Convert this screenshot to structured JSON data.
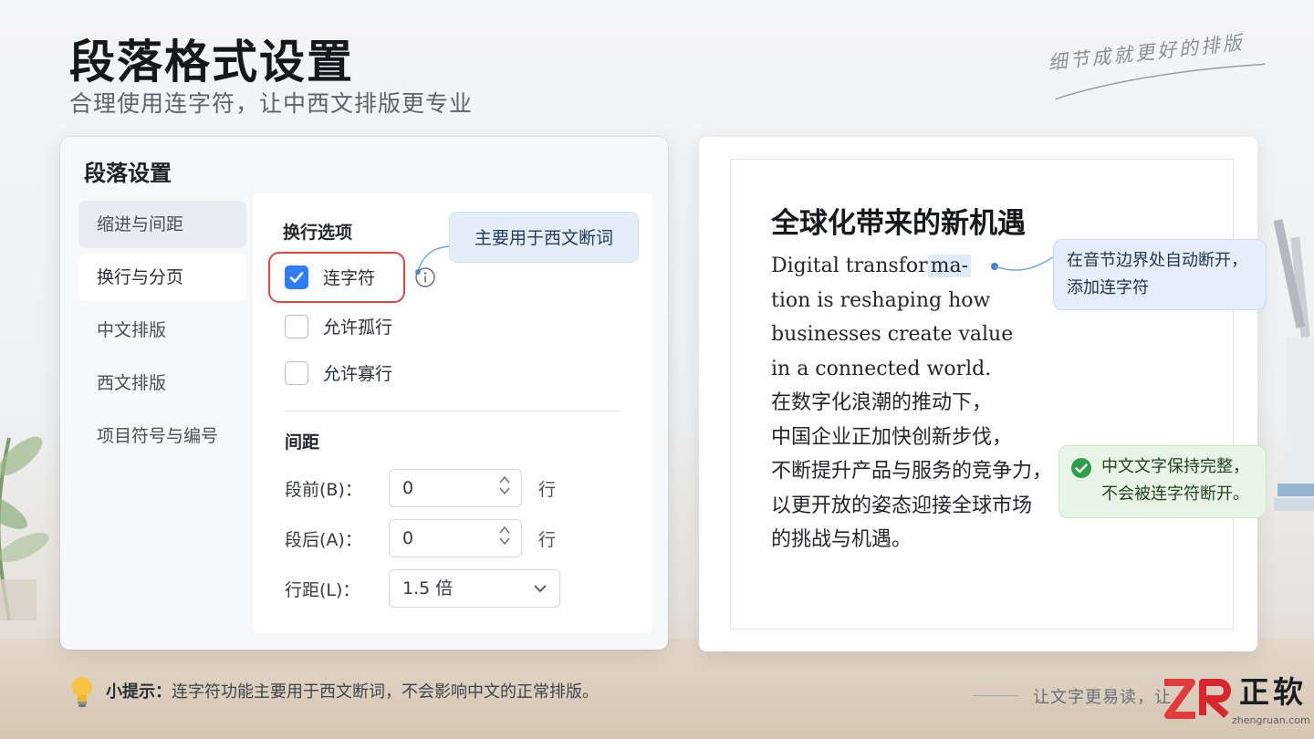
{
  "header": {
    "title": "段落格式设置",
    "subtitle": "合理使用连字符，让中西文排版更专业",
    "signature": "细节成就更好的排版"
  },
  "dialog": {
    "title": "段落设置",
    "nav": [
      {
        "label": "缩进与间距"
      },
      {
        "label": "换行与分页"
      },
      {
        "label": "中文排版"
      },
      {
        "label": "西文排版"
      },
      {
        "label": "项目符号与编号"
      }
    ],
    "line_break": {
      "title": "换行选项",
      "tooltip": "主要用于西文断词",
      "options": [
        {
          "label": "连字符",
          "checked": true
        },
        {
          "label": "允许孤行",
          "checked": false
        },
        {
          "label": "允许寡行",
          "checked": false
        }
      ]
    },
    "spacing": {
      "title": "间距",
      "before_label": "段前(B)：",
      "before_value": "0",
      "before_unit": "行",
      "after_label": "段后(A)：",
      "after_value": "0",
      "after_unit": "行",
      "line_label": "行距(L)：",
      "line_value": "1.5 倍"
    }
  },
  "document": {
    "title": "全球化带来的新机遇",
    "line1_main": "Digital transfor",
    "line1_mark": "ma-",
    "lines": [
      "tion is reshaping how",
      "businesses create value",
      "in a connected world.",
      "在数字化浪潮的推动下，",
      "中国企业正加快创新步伐，",
      "不断提升产品与服务的竞争力，",
      "以更开放的姿态迎接全球市场",
      "的挑战与机遇。"
    ],
    "callout_hyphen_1": "在音节边界处自动断开，",
    "callout_hyphen_2": "添加连字符",
    "callout_cn_1": "中文文字保持完整，",
    "callout_cn_2": "不会被连字符断开。"
  },
  "footer": {
    "tip_label": "小提示：",
    "tip_text": "连字符功能主要用于西文断词，不会影响中文的正常排版。",
    "slogan": "让文字更易读，让",
    "logo_text": "正软",
    "logo_url": "zhengruan.com"
  },
  "colors": {
    "accent_blue": "#2f7df6",
    "highlight_red": "#e0473c",
    "success_green": "#2e9e48"
  }
}
